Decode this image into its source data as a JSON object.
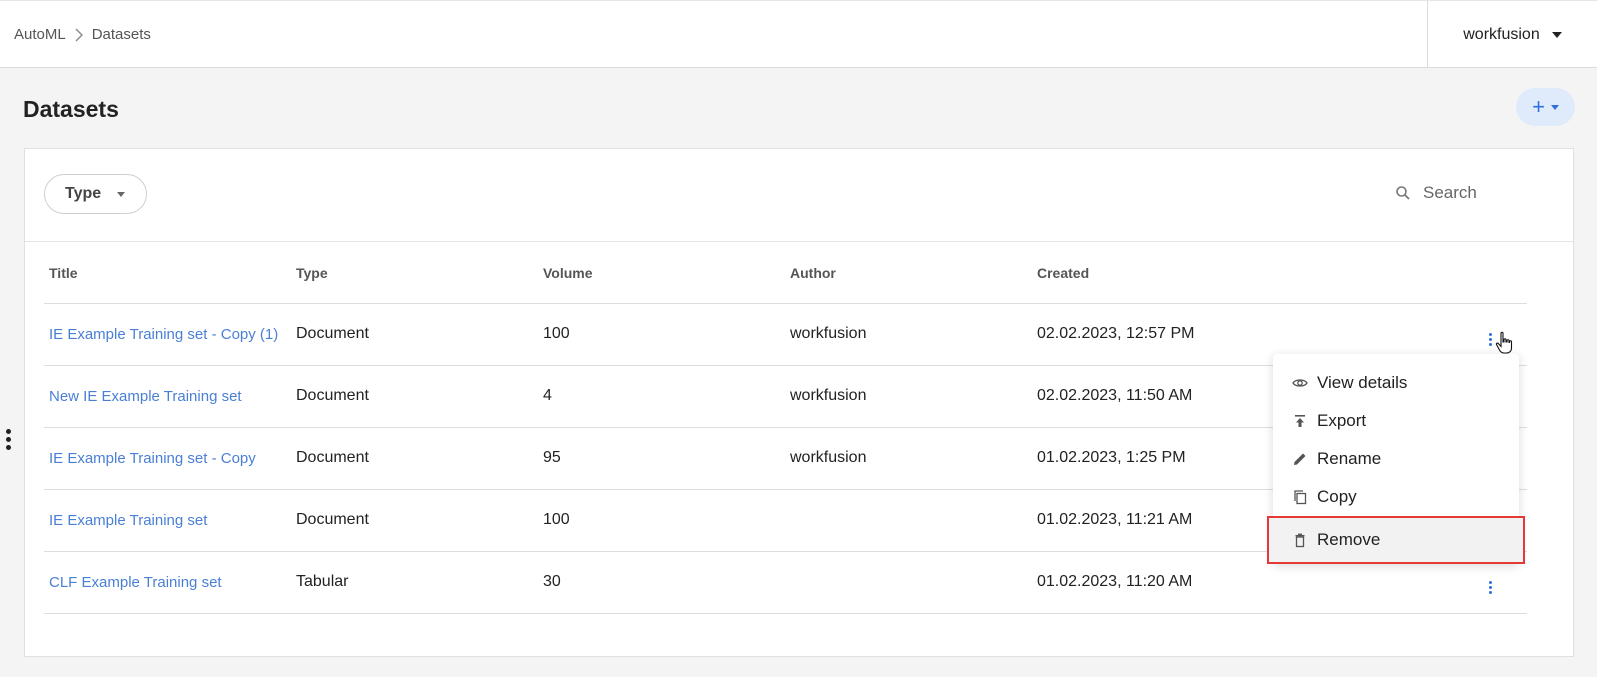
{
  "header": {
    "breadcrumb": [
      "AutoML",
      "Datasets"
    ],
    "user": "workfusion"
  },
  "page": {
    "title": "Datasets",
    "add_label": "+"
  },
  "filters": {
    "type_label": "Type",
    "search_placeholder": "Search"
  },
  "table": {
    "columns": [
      "Title",
      "Type",
      "Volume",
      "Author",
      "Created"
    ],
    "rows": [
      {
        "title": "IE Example Training set - Copy (1)",
        "type": "Document",
        "volume": "100",
        "author": "workfusion",
        "created": "02.02.2023, 12:57 PM"
      },
      {
        "title": "New IE Example Training set",
        "type": "Document",
        "volume": "4",
        "author": "workfusion",
        "created": "02.02.2023, 11:50 AM"
      },
      {
        "title": "IE Example Training set - Copy",
        "type": "Document",
        "volume": "95",
        "author": "workfusion",
        "created": "01.02.2023, 1:25 PM"
      },
      {
        "title": "IE Example Training set",
        "type": "Document",
        "volume": "100",
        "author": "",
        "created": "01.02.2023, 11:21 AM"
      },
      {
        "title": "CLF Example Training set",
        "type": "Tabular",
        "volume": "30",
        "author": "",
        "created": "01.02.2023, 11:20 AM"
      }
    ]
  },
  "context_menu": {
    "items": [
      {
        "label": "View details",
        "icon": "eye-icon"
      },
      {
        "label": "Export",
        "icon": "export-icon"
      },
      {
        "label": "Rename",
        "icon": "pencil-icon"
      },
      {
        "label": "Copy",
        "icon": "copy-icon"
      },
      {
        "label": "Remove",
        "icon": "trash-icon"
      }
    ]
  },
  "colors": {
    "link": "#4a7fd6",
    "accent": "#2f6fe0",
    "highlight_border": "#e53935"
  }
}
